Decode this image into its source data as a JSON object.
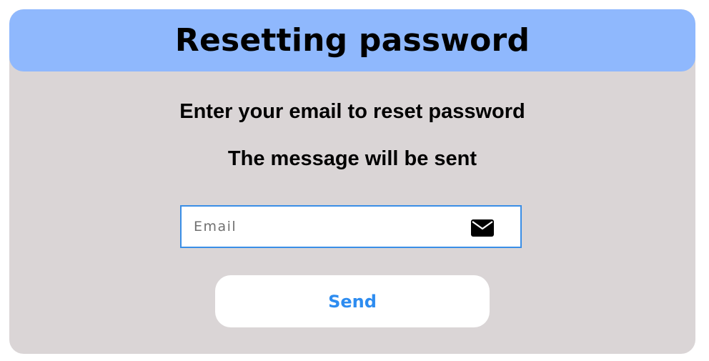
{
  "header": {
    "title": "Resetting password"
  },
  "instructions": {
    "line1": "Enter your email to reset password",
    "line2": "The message will be sent"
  },
  "email_field": {
    "placeholder": "Email",
    "value": "",
    "icon": "envelope-icon"
  },
  "send_button": {
    "label": "Send"
  },
  "colors": {
    "header_bg": "#8fb8fd",
    "card_bg": "#dad5d6",
    "field_border": "#3a8ee6",
    "button_text": "#2d8cf0"
  }
}
